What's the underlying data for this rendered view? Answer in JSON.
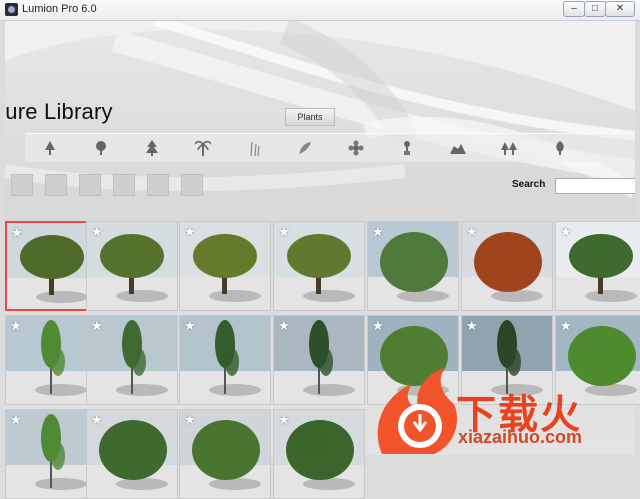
{
  "window": {
    "title": "Lumion Pro 6.0",
    "controls": {
      "minimize": "–",
      "maximize": "□",
      "close": "✕"
    }
  },
  "library": {
    "title": "ture Library",
    "active_tab": "Plants",
    "categories": [
      {
        "icon": "deciduous-tree-icon"
      },
      {
        "icon": "round-tree-icon"
      },
      {
        "icon": "conifer-tree-icon"
      },
      {
        "icon": "palm-tree-icon"
      },
      {
        "icon": "reed-icon"
      },
      {
        "icon": "leaves-icon"
      },
      {
        "icon": "flower-icon"
      },
      {
        "icon": "plant-pot-icon"
      },
      {
        "icon": "rock-icon"
      },
      {
        "icon": "forest-icon"
      },
      {
        "icon": "shrub-icon"
      }
    ],
    "filter_buttons": 6,
    "search": {
      "label": "Search",
      "value": ""
    }
  },
  "thumbnails": [
    [
      {
        "kind": "broadleaf",
        "bg": "#cfd8dc",
        "foliage": "#4f6b2a",
        "selected": true
      },
      {
        "kind": "broadleaf",
        "bg": "#d6dde0",
        "foliage": "#56722f",
        "selected": false
      },
      {
        "kind": "broadleaf",
        "bg": "#dadfe2",
        "foliage": "#667a2c",
        "selected": false
      },
      {
        "kind": "broadleaf",
        "bg": "#d8dfe2",
        "foliage": "#5f7a30",
        "selected": false
      },
      {
        "kind": "bush",
        "bg": "#b9c9d4",
        "foliage": "#4f7a3b",
        "selected": false
      },
      {
        "kind": "bush",
        "bg": "#d8dbe0",
        "foliage": "#a0441e",
        "selected": false
      },
      {
        "kind": "broadleaf",
        "bg": "#e9ecee",
        "foliage": "#3e6a2d",
        "selected": false
      }
    ],
    [
      {
        "kind": "slim",
        "bg": "#b7c8d2",
        "foliage": "#4f8a34",
        "selected": false
      },
      {
        "kind": "slim",
        "bg": "#b9c7cf",
        "foliage": "#3f6a32",
        "selected": false
      },
      {
        "kind": "slim",
        "bg": "#b3c3cc",
        "foliage": "#355c2b",
        "selected": false
      },
      {
        "kind": "slim",
        "bg": "#a9b8c0",
        "foliage": "#2f4f2a",
        "selected": false
      },
      {
        "kind": "bush",
        "bg": "#9eb3bf",
        "foliage": "#4f7d33",
        "selected": false
      },
      {
        "kind": "slim",
        "bg": "#8fa4ae",
        "foliage": "#2c4526",
        "selected": false
      },
      {
        "kind": "bush",
        "bg": "#a2b7c2",
        "foliage": "#4e8a2e",
        "selected": false
      }
    ],
    [
      {
        "kind": "slim",
        "bg": "#bfcbd2",
        "foliage": "#4f8a34",
        "selected": false
      },
      {
        "kind": "bush",
        "bg": "#d3d9dc",
        "foliage": "#3e6a2d",
        "selected": false
      },
      {
        "kind": "bush",
        "bg": "#cfd5d8",
        "foliage": "#4a7530",
        "selected": false
      },
      {
        "kind": "bush",
        "bg": "#d5dadc",
        "foliage": "#3b652a",
        "selected": false
      }
    ]
  ],
  "watermark": {
    "brand": "下载火",
    "url": "xiazaihuo.com"
  }
}
